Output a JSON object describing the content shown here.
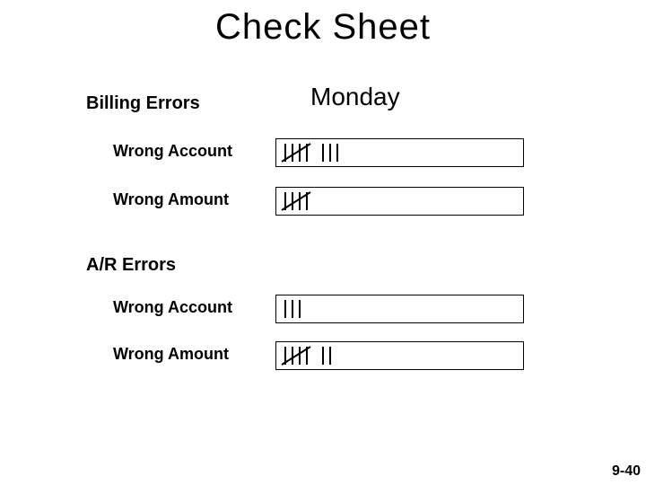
{
  "title": "Check Sheet",
  "day": "Monday",
  "sections": {
    "billing": {
      "label": "Billing Errors",
      "rows": {
        "wrong_account": {
          "label": "Wrong Account"
        },
        "wrong_amount": {
          "label": "Wrong Amount"
        }
      }
    },
    "ar": {
      "label": "A/R Errors",
      "rows": {
        "wrong_account": {
          "label": "Wrong Account"
        },
        "wrong_amount": {
          "label": "Wrong Amount"
        }
      }
    }
  },
  "footer": "9-40",
  "chart_data": {
    "type": "table",
    "title": "Check Sheet — tally counts for Monday",
    "categories": [
      "Billing / Wrong Account",
      "Billing / Wrong Amount",
      "A/R / Wrong Account",
      "A/R / Wrong Amount"
    ],
    "values": [
      8,
      5,
      3,
      7
    ]
  }
}
